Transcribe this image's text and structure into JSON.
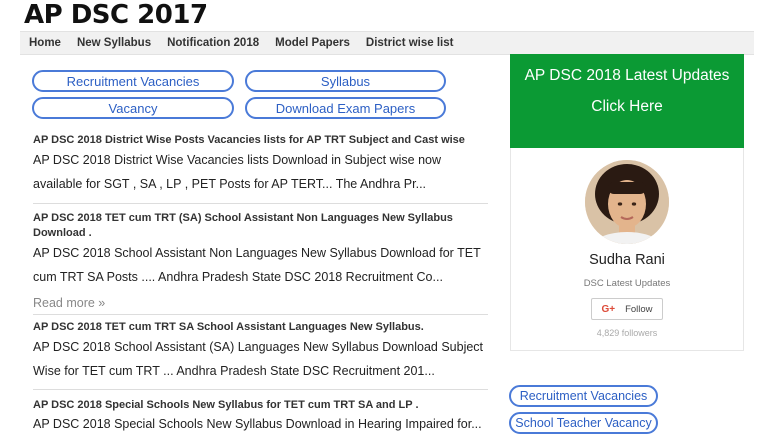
{
  "site": {
    "title": "AP DSC 2017"
  },
  "nav": {
    "items": [
      {
        "label": "Home"
      },
      {
        "label": "New Syllabus"
      },
      {
        "label": "Notification 2018"
      },
      {
        "label": "Model Papers"
      },
      {
        "label": "District wise list"
      }
    ]
  },
  "buttons": {
    "recruitment": "Recruitment Vacancies",
    "syllabus": "Syllabus",
    "vacancy": "Vacancy",
    "download": "Download Exam Papers"
  },
  "posts": [
    {
      "title": "AP DSC 2018 District Wise Posts Vacancies lists for AP TRT Subject and Cast wise",
      "snippet": "AP DSC 2018 District Wise Vacancies lists Download in Subject wise now available for SGT , SA , LP , PET Posts for AP TERT... The Andhra Pr..."
    },
    {
      "title": "AP DSC 2018 TET cum TRT (SA) School Assistant Non Languages New Syllabus Download .",
      "snippet": "AP DSC 2018 School Assistant Non Languages New Syllabus Download for TET cum TRT SA Posts .... Andhra Pradesh State DSC 2018 Recruitment Co..."
    },
    {
      "title": "AP DSC 2018 TET cum TRT SA School Assistant Languages New Syllabus.",
      "snippet": "AP DSC 2018 School Assistant (SA) Languages New Syllabus Download Subject Wise for TET cum TRT ... Andhra Pradesh State DSC Recruitment 201..."
    },
    {
      "title": "AP DSC 2018 Special Schools New Syllabus for TET cum TRT SA and LP .",
      "snippet": "AP DSC 2018 Special Schools New Syllabus Download in Hearing Impaired for..."
    }
  ],
  "read_more": "Read more »",
  "sidebar": {
    "promo_title": "AP DSC 2018 Latest Updates",
    "promo_cta": "Click Here",
    "profile_name": "Sudha Rani",
    "profile_tagline": "DSC Latest Updates",
    "follow_icon": "G+",
    "follow_label": "Follow",
    "followers": "4,829 followers",
    "link_recruitment": "Recruitment Vacancies",
    "link_school_teacher": "School Teacher Vacancy"
  },
  "colors": {
    "accent_blue": "#4a7ad8",
    "promo_green": "#0b9a34"
  }
}
